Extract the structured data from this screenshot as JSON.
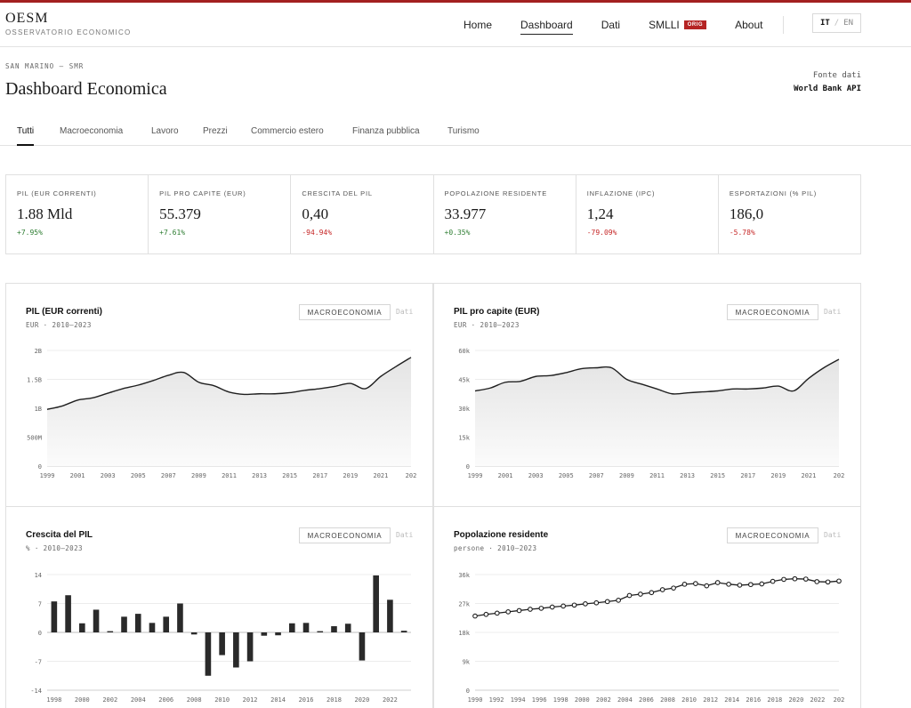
{
  "header": {
    "logo_title": "OESM",
    "logo_subtitle": "OSSERVATORIO ECONOMICO",
    "nav": [
      {
        "label": "Home",
        "active": false
      },
      {
        "label": "Dashboard",
        "active": true
      },
      {
        "label": "Dati",
        "active": false
      },
      {
        "label": "SMLLI",
        "active": false,
        "badge": "ORIG"
      },
      {
        "label": "About",
        "active": false
      }
    ],
    "lang_active": "IT",
    "lang_sep": "/",
    "lang_other": "EN"
  },
  "page": {
    "breadcrumb": "SAN MARINO — SMR",
    "title": "Dashboard Economica",
    "source_label": "Fonte dati",
    "source_value": "World Bank API"
  },
  "tabs": [
    "Tutti",
    "Macroeconomia",
    "Lavoro",
    "Prezzi",
    "Commercio estero",
    "Finanza pubblica",
    "Turismo"
  ],
  "kpis": [
    {
      "label": "PIL (EUR CORRENTI)",
      "value": "1.88 Mld",
      "delta": "+7.95%",
      "dir": "pos"
    },
    {
      "label": "PIL PRO CAPITE (EUR)",
      "value": "55.379",
      "delta": "+7.61%",
      "dir": "pos"
    },
    {
      "label": "CRESCITA DEL PIL",
      "value": "0,40",
      "delta": "-94.94%",
      "dir": "neg"
    },
    {
      "label": "POPOLAZIONE RESIDENTE",
      "value": "33.977",
      "delta": "+0.35%",
      "dir": "pos"
    },
    {
      "label": "INFLAZIONE (IPC)",
      "value": "1,24",
      "delta": "-79.09%",
      "dir": "neg"
    },
    {
      "label": "ESPORTAZIONI (% PIL)",
      "value": "186,0",
      "delta": "-5.78%",
      "dir": "neg"
    }
  ],
  "cards": [
    {
      "title": "PIL (EUR correnti)",
      "subtitle": "EUR · 2010–2023",
      "category": "MACROECONOMIA",
      "link": "Dati"
    },
    {
      "title": "PIL pro capite (EUR)",
      "subtitle": "EUR · 2010–2023",
      "category": "MACROECONOMIA",
      "link": "Dati"
    },
    {
      "title": "Crescita del PIL",
      "subtitle": "% · 2010–2023",
      "category": "MACROECONOMIA",
      "link": "Dati"
    },
    {
      "title": "Popolazione residente",
      "subtitle": "persone · 2010–2023",
      "category": "MACROECONOMIA",
      "link": "Dati"
    }
  ],
  "chart_data": [
    {
      "type": "area",
      "title": "PIL (EUR correnti)",
      "ylim": [
        0,
        2000000000
      ],
      "yticks": [
        "0",
        "500M",
        "1B",
        "1.5B",
        "2B"
      ],
      "xticks": [
        "1999",
        "2001",
        "2003",
        "2005",
        "2007",
        "2009",
        "2011",
        "2013",
        "2015",
        "2017",
        "2019",
        "2021",
        "202"
      ],
      "x": [
        1999,
        2000,
        2001,
        2002,
        2003,
        2004,
        2005,
        2006,
        2007,
        2008,
        2009,
        2010,
        2011,
        2012,
        2013,
        2014,
        2015,
        2016,
        2017,
        2018,
        2019,
        2020,
        2021,
        2022,
        2023
      ],
      "values": [
        980000000,
        1040000000,
        1140000000,
        1180000000,
        1260000000,
        1340000000,
        1400000000,
        1480000000,
        1570000000,
        1620000000,
        1450000000,
        1390000000,
        1280000000,
        1240000000,
        1250000000,
        1250000000,
        1270000000,
        1310000000,
        1340000000,
        1380000000,
        1430000000,
        1340000000,
        1550000000,
        1720000000,
        1880000000
      ]
    },
    {
      "type": "area",
      "title": "PIL pro capite (EUR)",
      "ylim": [
        0,
        60000
      ],
      "yticks": [
        "0",
        "15k",
        "30k",
        "45k",
        "60k"
      ],
      "xticks": [
        "1999",
        "2001",
        "2003",
        "2005",
        "2007",
        "2009",
        "2011",
        "2013",
        "2015",
        "2017",
        "2019",
        "2021",
        "202"
      ],
      "x": [
        1999,
        2000,
        2001,
        2002,
        2003,
        2004,
        2005,
        2006,
        2007,
        2008,
        2009,
        2010,
        2011,
        2012,
        2013,
        2014,
        2015,
        2016,
        2017,
        2018,
        2019,
        2020,
        2021,
        2022,
        2023
      ],
      "values": [
        39000,
        40500,
        43500,
        44000,
        46500,
        47000,
        48500,
        50500,
        51000,
        51000,
        45000,
        42500,
        40000,
        37500,
        38000,
        38500,
        39000,
        40000,
        40000,
        40500,
        41500,
        39000,
        45500,
        51000,
        55379
      ]
    },
    {
      "type": "bar",
      "title": "Crescita del PIL",
      "ylim": [
        -14,
        14
      ],
      "yticks": [
        "-14",
        "-7",
        "0",
        "7",
        "14"
      ],
      "xticks": [
        "1998",
        "2000",
        "2002",
        "2004",
        "2006",
        "2008",
        "2010",
        "2012",
        "2014",
        "2016",
        "2018",
        "2020",
        "2022"
      ],
      "x": [
        1998,
        1999,
        2000,
        2001,
        2002,
        2003,
        2004,
        2005,
        2006,
        2007,
        2008,
        2009,
        2010,
        2011,
        2012,
        2013,
        2014,
        2015,
        2016,
        2017,
        2018,
        2019,
        2020,
        2021,
        2022,
        2023
      ],
      "values": [
        7.5,
        9.0,
        2.2,
        5.5,
        0.3,
        3.8,
        4.5,
        2.3,
        3.8,
        7.0,
        -0.5,
        -10.5,
        -5.5,
        -8.5,
        -7.0,
        -0.8,
        -0.7,
        2.2,
        2.3,
        0.3,
        1.5,
        2.1,
        -6.8,
        13.8,
        7.9,
        0.4
      ]
    },
    {
      "type": "line",
      "title": "Popolazione residente",
      "ylim": [
        0,
        36000
      ],
      "yticks": [
        "0",
        "9k",
        "18k",
        "27k",
        "36k"
      ],
      "xticks": [
        "1990",
        "1992",
        "1994",
        "1996",
        "1998",
        "2000",
        "2002",
        "2004",
        "2006",
        "2008",
        "2010",
        "2012",
        "2014",
        "2016",
        "2018",
        "2020",
        "2022",
        "202"
      ],
      "x": [
        1990,
        1991,
        1992,
        1993,
        1994,
        1995,
        1996,
        1997,
        1998,
        1999,
        2000,
        2001,
        2002,
        2003,
        2004,
        2005,
        2006,
        2007,
        2008,
        2009,
        2010,
        2011,
        2012,
        2013,
        2014,
        2015,
        2016,
        2017,
        2018,
        2019,
        2020,
        2021,
        2022,
        2023
      ],
      "values": [
        23100,
        23600,
        24000,
        24400,
        24800,
        25200,
        25500,
        25900,
        26200,
        26500,
        26900,
        27200,
        27600,
        28000,
        29500,
        29900,
        30400,
        31300,
        31800,
        33000,
        33200,
        32500,
        33500,
        33000,
        32700,
        32900,
        33100,
        33900,
        34500,
        34700,
        34600,
        33800,
        33700,
        33977
      ]
    }
  ]
}
